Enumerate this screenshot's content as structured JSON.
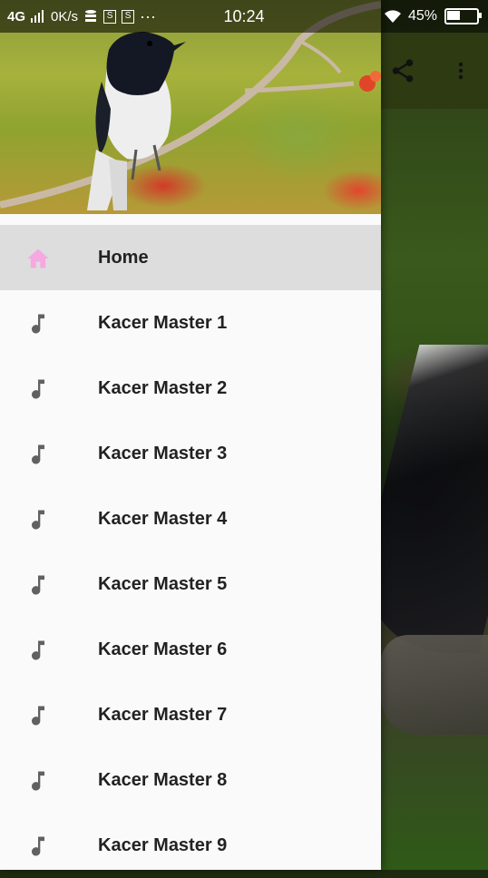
{
  "status_bar": {
    "network": "4G",
    "speed": "0K/s",
    "time": "10:24",
    "battery": "45%",
    "battery_level": 0.45,
    "overflow": "···"
  },
  "toolbar": {
    "share_icon": "share-icon",
    "more_icon": "more-vert-icon"
  },
  "drawer": {
    "header_image": "magpie-robin-bird-on-branch",
    "items": [
      {
        "label": "Home",
        "icon": "home-icon",
        "active": true,
        "icon_color": "#f6a8e0"
      },
      {
        "label": "Kacer Master 1",
        "icon": "music-note-icon"
      },
      {
        "label": "Kacer Master 2",
        "icon": "music-note-icon"
      },
      {
        "label": "Kacer Master 3",
        "icon": "music-note-icon"
      },
      {
        "label": "Kacer Master 4",
        "icon": "music-note-icon"
      },
      {
        "label": "Kacer Master 5",
        "icon": "music-note-icon"
      },
      {
        "label": "Kacer Master 6",
        "icon": "music-note-icon"
      },
      {
        "label": "Kacer Master 7",
        "icon": "music-note-icon"
      },
      {
        "label": "Kacer Master 8",
        "icon": "music-note-icon"
      },
      {
        "label": "Kacer Master 9",
        "icon": "music-note-icon"
      }
    ]
  },
  "colors": {
    "drawer_bg": "#fafafa",
    "active_bg": "#dddddd",
    "icon_gray": "#616161",
    "text": "#222222"
  }
}
